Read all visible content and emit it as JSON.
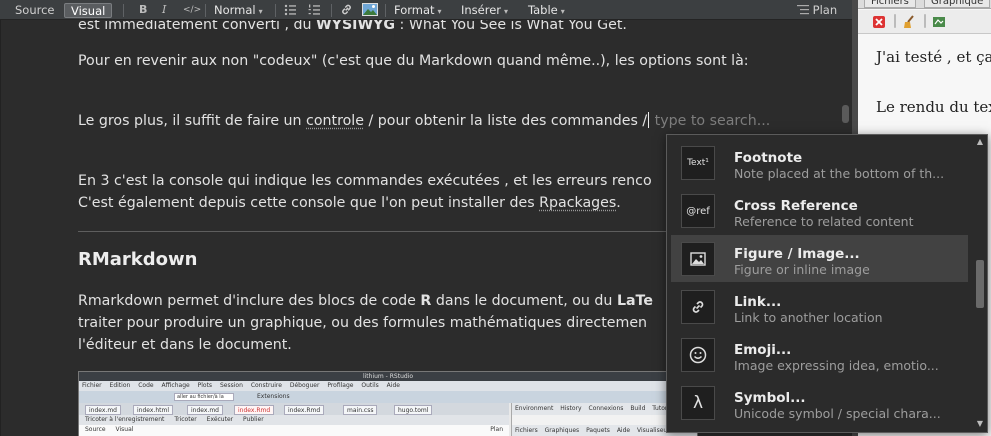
{
  "toolbar": {
    "source_label": "Source",
    "visual_label": "Visual",
    "bold_label": "B",
    "italic_label": "I",
    "code_label": "</>",
    "format_select_value": "Normal",
    "format_menu_label": "Format",
    "insert_menu_label": "Insérer",
    "table_menu_label": "Table",
    "outline_label": "Plan"
  },
  "document": {
    "line_top_pre": "est immédiatement converti , du ",
    "line_top_bold": "WYSIWYG",
    "line_top_post": " : What You See is What You Get.",
    "p1": "Pour en revenir aux non \"codeux\" (c'est que du Markdown quand même..),  les options sont là:",
    "p2_pre": "Le gros plus, il suffit de faire un  ",
    "p2_link": "controle",
    "p2_mid": " / pour obtenir la liste des commandes /",
    "p2_placeholder": " type to search...",
    "p3_line1": "En 3 c'est la console qui indique les commandes exécutées , et les erreurs renco",
    "p3_line2_pre": "C'est également depuis cette console que l'on peut installer des ",
    "p3_link": "Rpackages",
    "p3_line2_post": ".",
    "heading": "RMarkdown",
    "p4_line1_pre": "Rmarkdown permet d'inclure des blocs de code ",
    "p4_bold1": "R",
    "p4_line1_mid": " dans le document, ou du ",
    "p4_bold2": "LaTe",
    "p4_line2": "traiter pour produire un graphique, ou des formules mathématiques directemen",
    "p4_line3": "l'éditeur et dans le document."
  },
  "embedded_screenshot": {
    "title": "lithium - RStudio",
    "menu": [
      "Fichier",
      "Edition",
      "Code",
      "Affichage",
      "Plots",
      "Session",
      "Construire",
      "Déboguer",
      "Profilage",
      "Outils",
      "Aide"
    ],
    "tabs": [
      "index.md",
      "index.html",
      "index.md",
      "index.Rmd",
      "index.Rmd",
      "main.css",
      "hugo.toml"
    ],
    "panel_tabs": [
      "Environment",
      "History",
      "Connexions",
      "Build",
      "Tutorial"
    ],
    "panel_tabs2": [
      "Fichiers",
      "Graphiques",
      "Paquets",
      "Aide",
      "Visualiseur"
    ],
    "source_tabs": [
      "Source",
      "Visual"
    ],
    "address": "aller au fichier/à la",
    "addins": "Extensions",
    "run_label": "Exécuter",
    "publish_label": "Publier",
    "save_label": "Tricoter à l'enregistrement",
    "knit_label": "Tricoter",
    "plan_label": "Plan"
  },
  "right_pane": {
    "tab1": "Fichiers",
    "tab2": "Graphique",
    "text_line1": "J'ai testé , et ça",
    "text_line2": "Le rendu du tex"
  },
  "popup": {
    "items": [
      {
        "icon": "Text¹",
        "title": "Footnote",
        "desc": "Note placed at the bottom of th..."
      },
      {
        "icon": "@ref",
        "title": "Cross Reference",
        "desc": "Reference to related content"
      },
      {
        "icon": "image",
        "title": "Figure / Image...",
        "desc": "Figure or inline image"
      },
      {
        "icon": "link",
        "title": "Link...",
        "desc": "Link to another location"
      },
      {
        "icon": "emoji",
        "title": "Emoji...",
        "desc": "Image expressing idea, emotio..."
      },
      {
        "icon": "λ",
        "title": "Symbol...",
        "desc": "Unicode symbol / special chara..."
      }
    ],
    "selected_index": 2
  },
  "colors": {
    "editor_bg": "#2c2c2c",
    "popup_bg": "#2b2b2b",
    "popup_selected": "#424242",
    "text": "#e2e2e2"
  }
}
